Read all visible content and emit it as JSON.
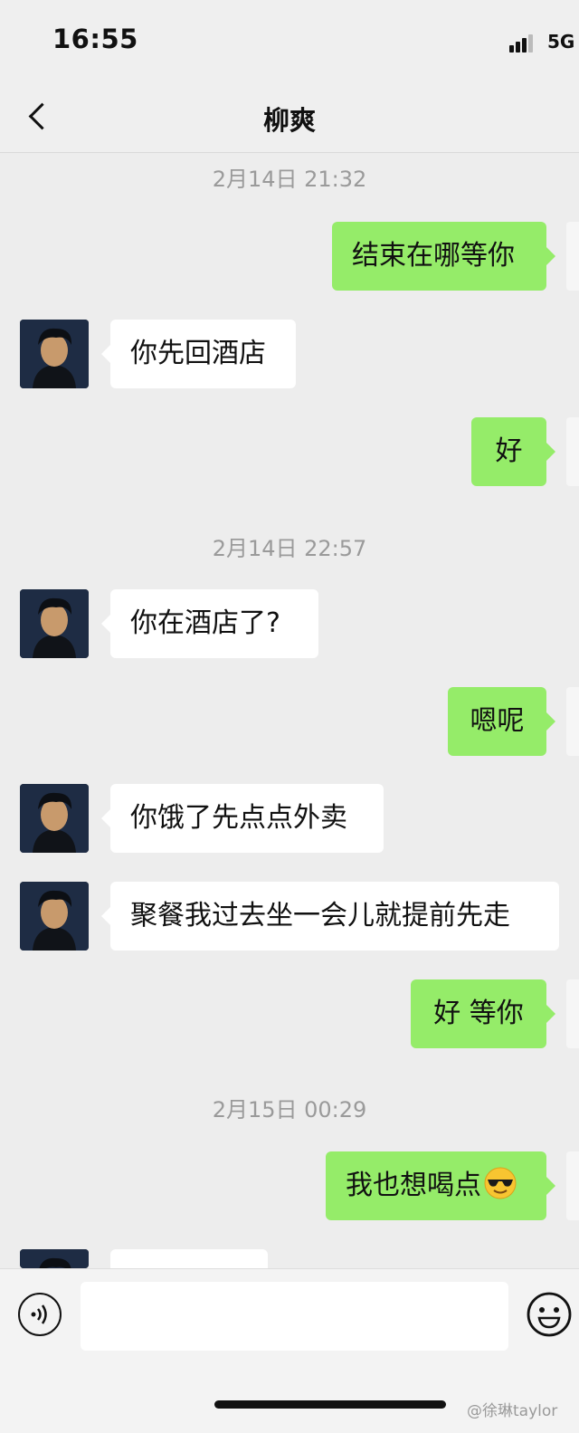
{
  "status_bar": {
    "time": "16:55",
    "network": "5G"
  },
  "header": {
    "title": "柳爽"
  },
  "messages": [
    {
      "kind": "timestamp",
      "text": "2月14日 21:32"
    },
    {
      "kind": "outgoing",
      "text": "结束在哪等你"
    },
    {
      "kind": "incoming",
      "text": "你先回酒店"
    },
    {
      "kind": "outgoing",
      "text": "好"
    },
    {
      "kind": "timestamp",
      "text": "2月14日 22:57"
    },
    {
      "kind": "incoming",
      "text": "你在酒店了?"
    },
    {
      "kind": "outgoing",
      "text": "嗯呢"
    },
    {
      "kind": "incoming",
      "text": "你饿了先点点外卖"
    },
    {
      "kind": "incoming",
      "text": "聚餐我过去坐一会儿就提前先走"
    },
    {
      "kind": "outgoing",
      "text": "好 等你"
    },
    {
      "kind": "timestamp",
      "text": "2月15日 00:29"
    },
    {
      "kind": "outgoing",
      "text": "我也想喝点",
      "emoji": "sunglasses-emoji"
    }
  ],
  "input_bar": {
    "voice_icon": "voice-icon",
    "emoji_icon": "emoji-icon"
  },
  "watermark": "@徐琳taylor",
  "colors": {
    "outgoing_bubble": "#95ec69",
    "incoming_bubble": "#ffffff",
    "background": "#ededed"
  }
}
